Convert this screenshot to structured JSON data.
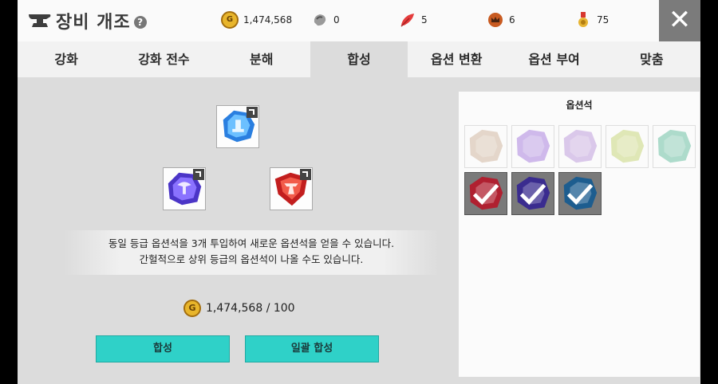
{
  "header": {
    "title": "장비 개조",
    "help": "?",
    "close": "✕"
  },
  "resources": [
    {
      "icon": "gold-coin-icon",
      "value": "1,474,568"
    },
    {
      "icon": "silver-ore-icon",
      "value": "0"
    },
    {
      "icon": "red-feather-icon",
      "value": "5"
    },
    {
      "icon": "crown-emblem-icon",
      "value": "6"
    },
    {
      "icon": "medal-icon",
      "value": "75"
    }
  ],
  "tabs": [
    "강화",
    "강화 전수",
    "분해",
    "합성",
    "옵션 변환",
    "옵션 부여",
    "맞춤"
  ],
  "active_tab": "합성",
  "synthesis": {
    "description_line1": "동일 등급 옵션석을 3개 투입하여 새로운 옵션석을 얻을 수 있습니다.",
    "description_line2": "간헐적으로 상위 등급의 옵션석이 나올 수도 있습니다.",
    "coin_glyph": "G",
    "cost": "1,474,568 / 100",
    "synthesize_button": "합성",
    "bulk_synthesize_button": "일괄 합성"
  },
  "inventory": {
    "title": "옵션석",
    "items": [
      {
        "color": "#c9ab8f",
        "state": "dim"
      },
      {
        "color": "#9a6ad8",
        "state": "dim"
      },
      {
        "color": "#b48bd6",
        "state": "dim"
      },
      {
        "color": "#bfcf63",
        "state": "dim"
      },
      {
        "color": "#4fb592",
        "state": "dim"
      },
      {
        "color": "#b02030",
        "state": "selected"
      },
      {
        "color": "#3a2c8f",
        "state": "selected"
      },
      {
        "color": "#1d5d8f",
        "state": "selected"
      }
    ]
  },
  "colors": {
    "accent_button": "#2fd1c8",
    "close_bg": "#7b7b7b"
  }
}
